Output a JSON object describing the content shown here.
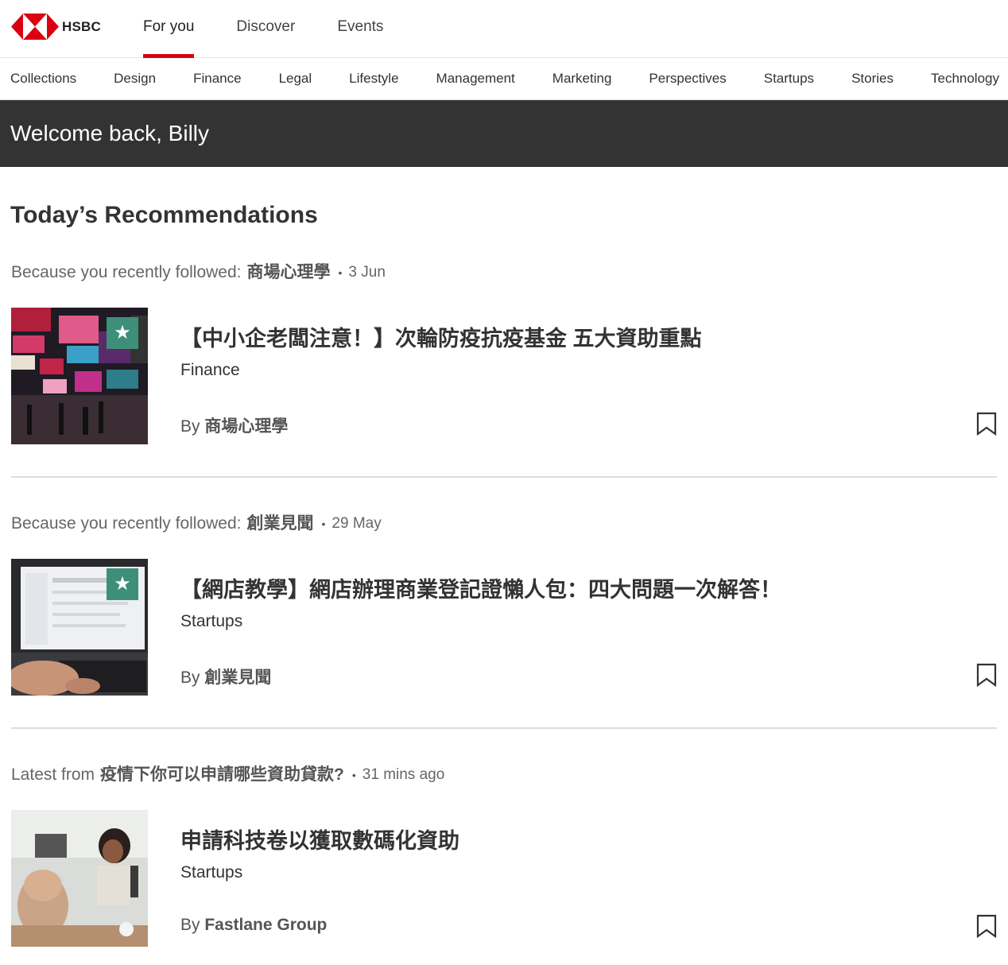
{
  "header": {
    "brand": "HSBC",
    "nav": [
      {
        "label": "For you",
        "active": true
      },
      {
        "label": "Discover",
        "active": false
      },
      {
        "label": "Events",
        "active": false
      }
    ],
    "accent_color": "#db0011"
  },
  "categories": [
    "Collections",
    "Design",
    "Finance",
    "Legal",
    "Lifestyle",
    "Management",
    "Marketing",
    "Perspectives",
    "Startups",
    "Stories",
    "Technology"
  ],
  "welcome": "Welcome back, Billy",
  "section_title": "Today’s Recommendations",
  "recommendations": [
    {
      "reason_prefix": "Because you recently followed:",
      "reason_source": "商場心理學",
      "separator": "•",
      "time": "3 Jun",
      "title": "【中小企老闆注意！】次輪防疫抗疫基金 五大資助重點",
      "category": "Finance",
      "by_label": "By",
      "author": "商場心理學",
      "featured": true,
      "star_icon": "★"
    },
    {
      "reason_prefix": "Because you recently followed:",
      "reason_source": "創業見聞",
      "separator": "•",
      "time": "29 May",
      "title": "【網店教學】網店辦理商業登記證懶人包：四大問題一次解答！",
      "category": "Startups",
      "by_label": "By",
      "author": "創業見聞",
      "featured": true,
      "star_icon": "★"
    },
    {
      "reason_prefix": "Latest from",
      "reason_source": "疫情下你可以申請哪些資助貸款?",
      "separator": "•",
      "time": "31 mins ago",
      "title": "申請科技卷以獲取數碼化資助",
      "category": "Startups",
      "by_label": "By",
      "author": "Fastlane Group",
      "featured": false,
      "star_icon": ""
    }
  ]
}
